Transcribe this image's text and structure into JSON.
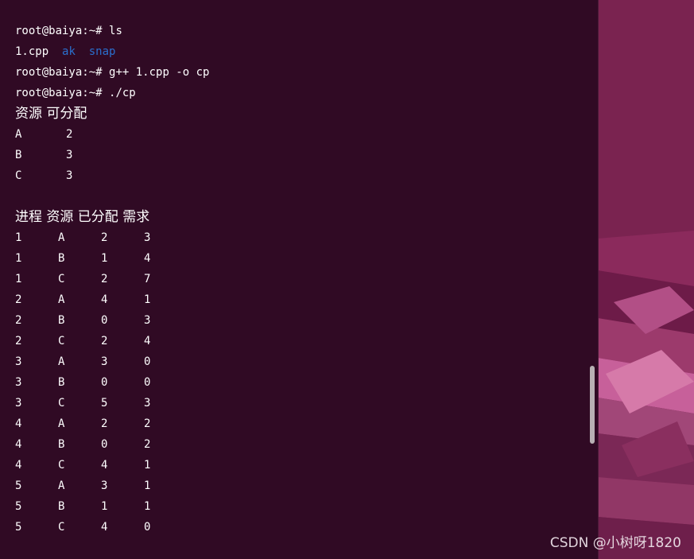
{
  "terminal": {
    "prompt": "root@baiya:~#",
    "lines": {
      "l1_cmd": "ls",
      "l2_files": [
        "1.cpp",
        "ak",
        "snap"
      ],
      "l3_cmd": "g++ 1.cpp -o cp",
      "l4_cmd": "./cp"
    },
    "resource_header": "资源 可分配",
    "resources": [
      {
        "name": "A",
        "available": "2"
      },
      {
        "name": "B",
        "available": "3"
      },
      {
        "name": "C",
        "available": "3"
      }
    ],
    "process_header": "进程 资源 已分配 需求",
    "process_rows": [
      [
        "1",
        "A",
        "2",
        "3"
      ],
      [
        "1",
        "B",
        "1",
        "4"
      ],
      [
        "1",
        "C",
        "2",
        "7"
      ],
      [
        "2",
        "A",
        "4",
        "1"
      ],
      [
        "2",
        "B",
        "0",
        "3"
      ],
      [
        "2",
        "C",
        "2",
        "4"
      ],
      [
        "3",
        "A",
        "3",
        "0"
      ],
      [
        "3",
        "B",
        "0",
        "0"
      ],
      [
        "3",
        "C",
        "5",
        "3"
      ],
      [
        "4",
        "A",
        "2",
        "2"
      ],
      [
        "4",
        "B",
        "0",
        "2"
      ],
      [
        "4",
        "C",
        "4",
        "1"
      ],
      [
        "5",
        "A",
        "3",
        "1"
      ],
      [
        "5",
        "B",
        "1",
        "1"
      ],
      [
        "5",
        "C",
        "4",
        "0"
      ]
    ]
  },
  "watermark": "CSDN @小树呀1820",
  "colors": {
    "terminal_bg": "#300a24",
    "text": "#ffffff",
    "directory": "#2a6fce",
    "wallpaper": "#7a2350"
  }
}
